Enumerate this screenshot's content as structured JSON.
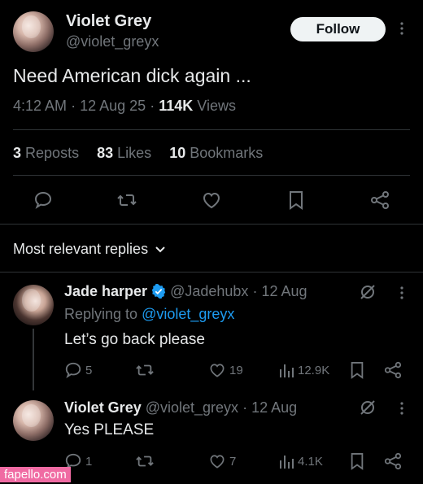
{
  "post": {
    "author_name": "Violet Grey",
    "author_handle": "@violet_greyx",
    "follow_label": "Follow",
    "text": "Need American dick again ...",
    "time": "4:12 AM",
    "sep1": "·",
    "date": "12 Aug 25",
    "sep2": "·",
    "views_count": "114K",
    "views_label": "Views",
    "stats": {
      "reposts_count": "3",
      "reposts_label": "Reposts",
      "likes_count": "83",
      "likes_label": "Likes",
      "bookmarks_count": "10",
      "bookmarks_label": "Bookmarks"
    }
  },
  "replies_header": "Most relevant replies",
  "replies": [
    {
      "name": "Jade harper",
      "handle": "@Jadehubx",
      "sep": "·",
      "date": "12 Aug",
      "replying_prefix": "Replying to",
      "replying_handle": "@violet_greyx",
      "text": "Let’s go back please",
      "comments": "5",
      "likes": "19",
      "views": "12.9K"
    },
    {
      "name": "Violet Grey",
      "handle": "@violet_greyx",
      "sep": "·",
      "date": "12 Aug",
      "text": "Yes PLEASE",
      "comments": "1",
      "likes": "7",
      "views": "4.1K"
    }
  ],
  "watermark": "fapello.com",
  "colors": {
    "background": "#000000",
    "text": "#e7e9ea",
    "muted": "#71767b",
    "link": "#1d9bf0",
    "divider": "#2f3336",
    "verified": "#1d9bf0"
  }
}
